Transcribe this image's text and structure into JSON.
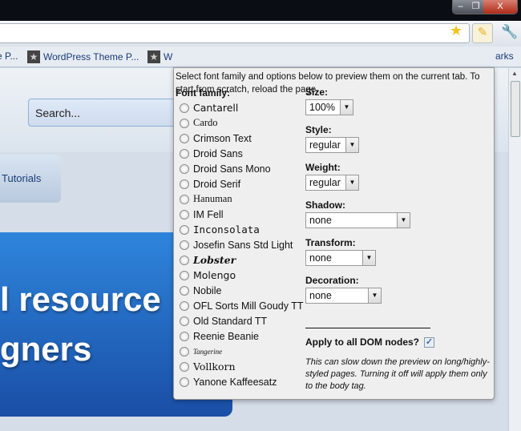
{
  "window": {
    "min": "–",
    "max": "❐",
    "close": "X"
  },
  "bookmarks": [
    "e P...",
    "WordPress Theme P...",
    "W",
    "arks"
  ],
  "page": {
    "search": "Search...",
    "nav_tab": "Tutorials",
    "hero_line1": "l resource",
    "hero_line2": "gners"
  },
  "popup": {
    "intro": "Select font family and options below to preview them on the current tab. To start from scratch, reload the page.",
    "font_family_label": "Font family:",
    "fonts": [
      "Cantarell",
      "Cardo",
      "Crimson Text",
      "Droid Sans",
      "Droid Sans Mono",
      "Droid Serif",
      "Hanuman",
      "IM Fell",
      "Inconsolata",
      "Josefin Sans Std Light",
      "Lobster",
      "Molengo",
      "Nobile",
      "OFL Sorts Mill Goudy TT",
      "Old Standard TT",
      "Reenie Beanie",
      "Tangerine",
      "Vollkorn",
      "Yanone Kaffeesatz"
    ],
    "size": {
      "label": "Size:",
      "value": "100%"
    },
    "style": {
      "label": "Style:",
      "value": "regular"
    },
    "weight": {
      "label": "Weight:",
      "value": "regular"
    },
    "shadow": {
      "label": "Shadow:",
      "value": "none"
    },
    "transform": {
      "label": "Transform:",
      "value": "none"
    },
    "decoration": {
      "label": "Decoration:",
      "value": "none"
    },
    "apply_label": "Apply to all DOM nodes?",
    "apply_checked": true,
    "note": "This can slow down the preview on long/highly-styled pages. Turning it off will apply them only to the body tag."
  }
}
